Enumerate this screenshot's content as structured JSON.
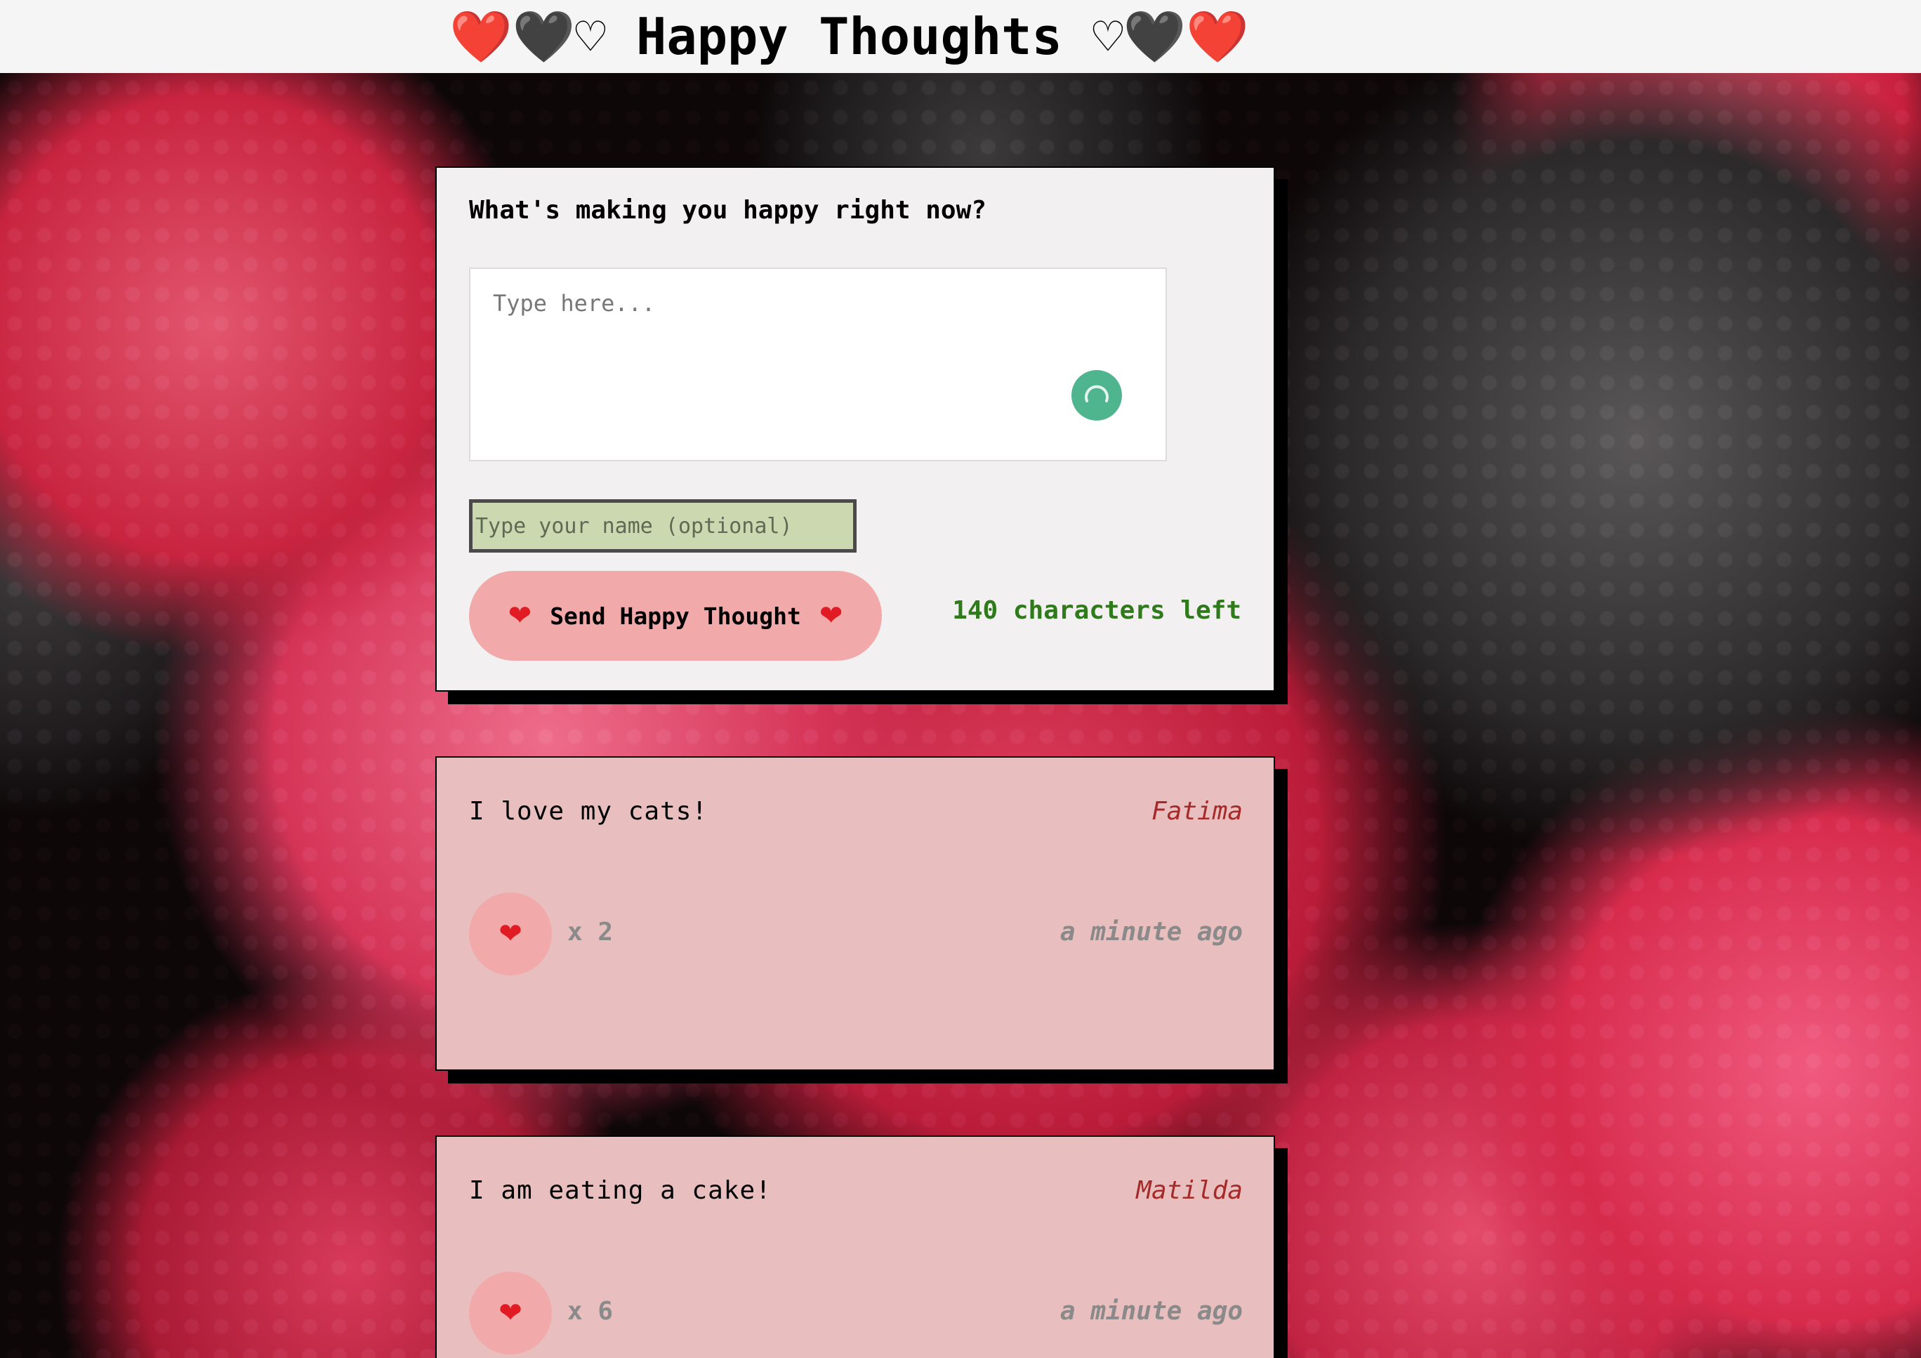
{
  "header": {
    "title": "❤️🖤♡ Happy Thoughts ♡🖤❤️"
  },
  "form": {
    "question": "What's making you happy right now?",
    "thought_placeholder": "Type here...",
    "thought_value": "",
    "name_placeholder": "Type your name (optional)",
    "name_value": "",
    "send_button_label": "Send Happy Thought",
    "send_button_icon": "heart-icon",
    "characters_left": "140 characters left",
    "grammar_badge_icon": "loading-spinner-icon"
  },
  "thoughts": [
    {
      "message": "I love my cats!",
      "author": "Fatima",
      "likes": "x 2",
      "time": "a minute ago"
    },
    {
      "message": "I am eating a cake!",
      "author": "Matilda",
      "likes": "x 6",
      "time": "a minute ago"
    }
  ],
  "colors": {
    "header_bg": "#f5f5f5",
    "form_bg": "#f2f0f1",
    "thought_bg": "#e8bebe",
    "button_pink": "#f2a9a9",
    "name_input_bg": "#cbd8b0",
    "counter_green": "#2f7a1a",
    "author_red": "#a52a2a",
    "badge_green": "#4fb58f"
  }
}
